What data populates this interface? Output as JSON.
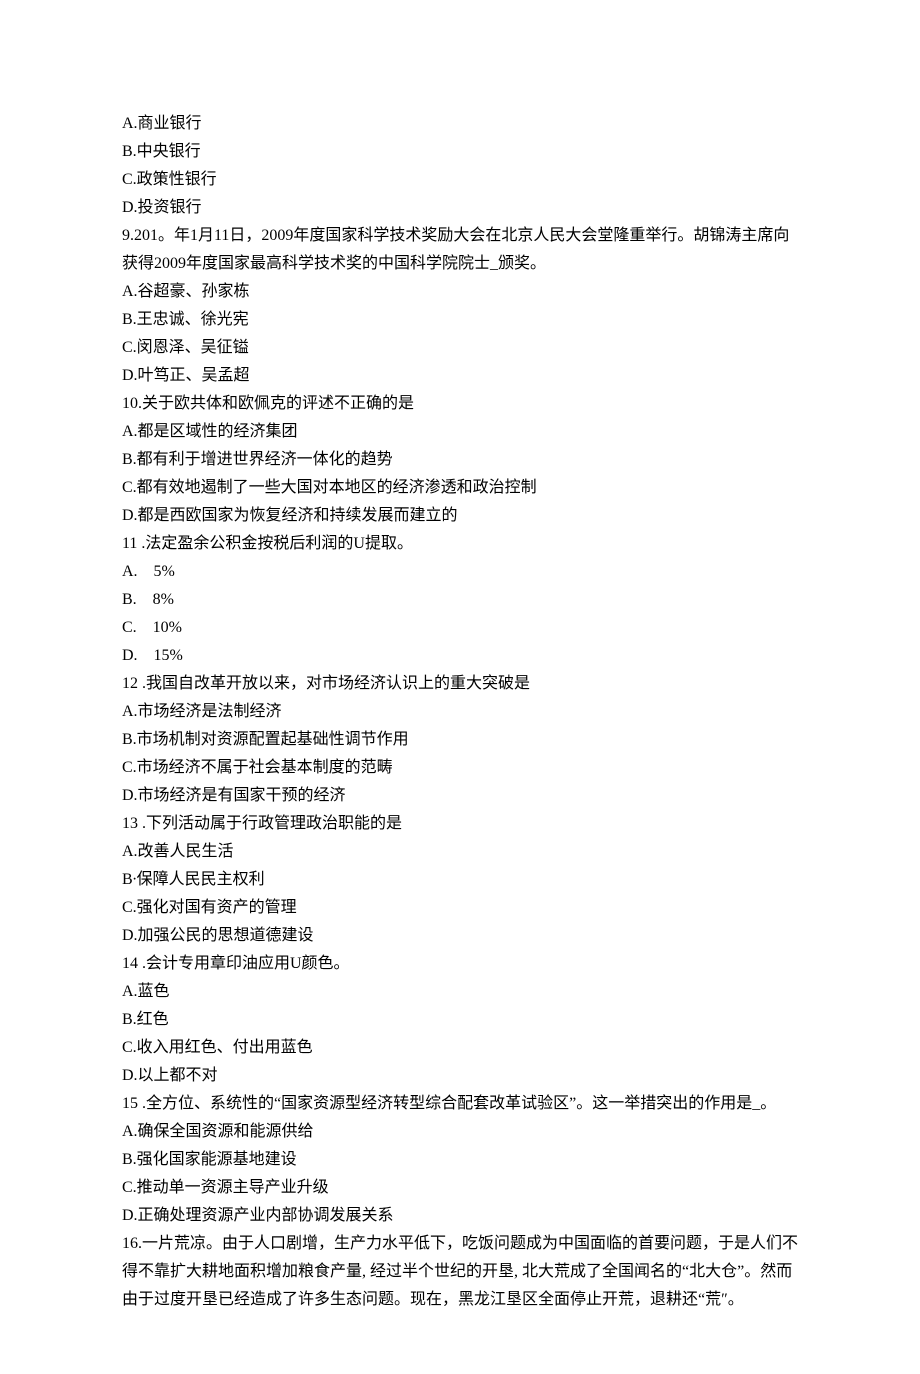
{
  "lines": [
    "A.商业银行",
    "B.中央银行",
    "C.政策性银行",
    "D.投资银行",
    "9.201。年1月11日，2009年度国家科学技术奖励大会在北京人民大会堂隆重举行。胡锦涛主席向获得2009年度国家最高科学技术奖的中国科学院院士_颁奖。",
    "A.谷超豪、孙家栋",
    "B.王忠诚、徐光宪",
    "C.闵恩泽、吴征镒",
    "D.叶笃正、吴孟超",
    "10.关于欧共体和欧佩克的评述不正确的是",
    "A.都是区域性的经济集团",
    "B.都有利于增进世界经济一体化的趋势",
    "C.都有效地遏制了一些大国对本地区的经济渗透和政治控制",
    "D.都是西欧国家为恢复经济和持续发展而建立的",
    "11 .法定盈余公积金按税后利润的U提取。",
    "A.    5%",
    "B.    8%",
    "C.    10%",
    "D.    15%",
    "12 .我国自改革开放以来，对市场经济认识上的重大突破是",
    "A.市场经济是法制经济",
    "B.市场机制对资源配置起基础性调节作用",
    "C.市场经济不属于社会基本制度的范畴",
    "D.市场经济是有国家干预的经济",
    "13 .下列活动属于行政管理政治职能的是",
    "A.改善人民生活",
    "B∙保障人民民主权利",
    "C.强化对国有资产的管理",
    "D.加强公民的思想道德建设",
    "14 .会计专用章印油应用U颜色。",
    "A.蓝色",
    "B.红色",
    "C.收入用红色、付出用蓝色",
    "D.以上都不对",
    "15 .全方位、系统性的“国家资源型经济转型综合配套改革试验区”。这一举措突出的作用是_。",
    "A.确保全国资源和能源供给",
    "B.强化国家能源基地建设",
    "C.推动单一资源主导产业升级",
    "D.正确处理资源产业内部协调发展关系",
    "16.一片荒凉。由于人口剧增，生产力水平低下，吃饭问题成为中国面临的首要问题，于是人们不得不靠扩大耕地面积增加粮食产量, 经过半个世纪的开垦, 北大荒成了全国闻名的“北大仓”。然而由于过度开垦已经造成了许多生态问题。现在，黑龙江垦区全面停止开荒，退耕还“荒″。"
  ]
}
